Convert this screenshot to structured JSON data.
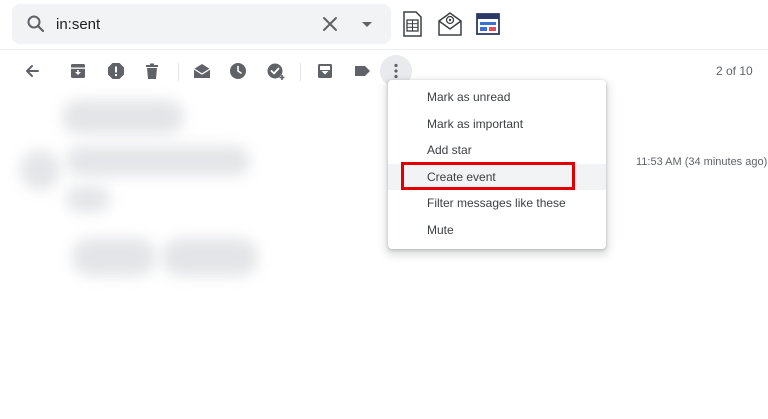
{
  "search": {
    "value": "in:sent",
    "icons": [
      "search-icon",
      "clear-icon",
      "search-options-dropdown-icon"
    ]
  },
  "addons": [
    "sheets-icon",
    "email-addon-icon",
    "template-addon-icon"
  ],
  "toolbar": {
    "icons": [
      "back-arrow-icon",
      "archive-icon",
      "report-spam-icon",
      "delete-icon",
      "mark-unread-icon",
      "snooze-icon",
      "add-to-tasks-icon",
      "move-to-icon",
      "label-icon",
      "more-options-icon"
    ],
    "page_count": "2 of 10"
  },
  "message": {
    "timestamp": "11:53 AM (34 minutes ago)"
  },
  "menu": {
    "items": [
      {
        "label": "Mark as unread"
      },
      {
        "label": "Mark as important"
      },
      {
        "label": "Add star"
      },
      {
        "label": "Create event"
      },
      {
        "label": "Filter messages like these"
      },
      {
        "label": "Mute"
      }
    ],
    "highlighted_item": "Create event",
    "highlight_color": "#e00000"
  },
  "colors": {
    "icon": "#5f6368",
    "search_bg": "#f1f3f4"
  }
}
